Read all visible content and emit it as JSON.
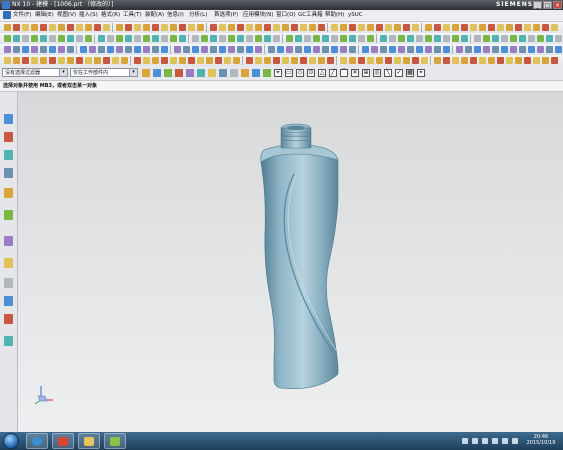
{
  "window": {
    "title": "NX 10 - 建模 - [1006.prt （修改的）]",
    "brand": "SIEMENS",
    "controls": [
      "_",
      "□",
      "×"
    ]
  },
  "menu": {
    "items": [
      "文件(F)",
      "编辑(E)",
      "视图(V)",
      "插入(S)",
      "格式(R)",
      "工具(T)",
      "装配(A)",
      "信息(I)",
      "分析(L)",
      "首选项(P)",
      "应用模块(N)",
      "窗口(O)",
      "GC工具箱",
      "帮助(H)",
      "ySUC"
    ]
  },
  "selection_bar": {
    "filter_value": "没有选择过滤器",
    "scope_value": "仅在工作部件内"
  },
  "status": {
    "prompt": "选择对象并使用 MB3，或者双击某一对象"
  },
  "colors": {
    "model": "#7fa8ba",
    "model_shadow": "#4f7c90",
    "model_highlight": "#b5d2df"
  },
  "taskbar": {
    "time": "20:46",
    "date": "2015/10/19"
  }
}
